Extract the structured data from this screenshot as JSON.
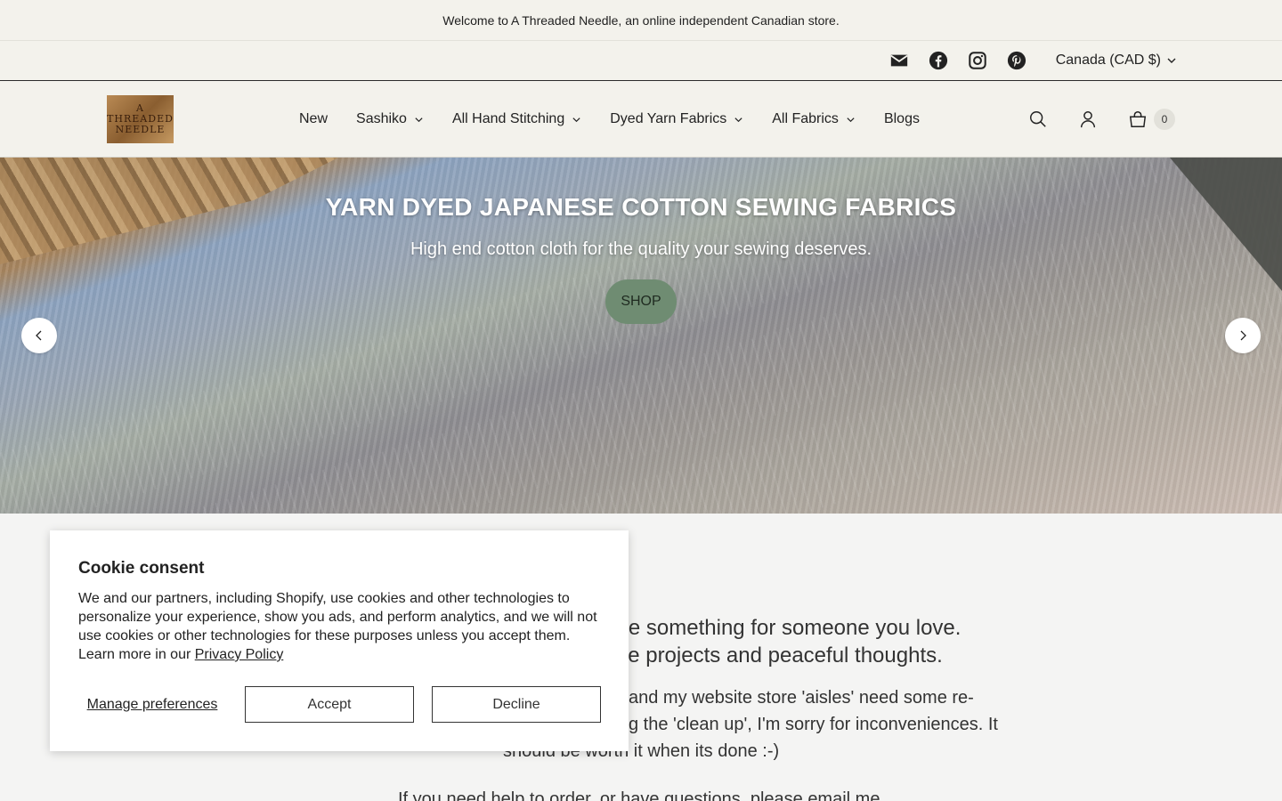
{
  "announcement": {
    "text": "Welcome to A Threaded Needle, an online independent Canadian store."
  },
  "utility": {
    "social_icons": [
      "mail-icon",
      "facebook-icon",
      "instagram-icon",
      "pinterest-icon"
    ],
    "currency": "Canada (CAD $)"
  },
  "header": {
    "logo_lines": [
      "A",
      "THREADED",
      "NEEDLE"
    ],
    "nav": [
      {
        "label": "New",
        "has_dropdown": false
      },
      {
        "label": "Sashiko",
        "has_dropdown": true
      },
      {
        "label": "All Hand Stitching",
        "has_dropdown": true
      },
      {
        "label": "Dyed Yarn Fabrics",
        "has_dropdown": true
      },
      {
        "label": "All Fabrics",
        "has_dropdown": true
      },
      {
        "label": "Blogs",
        "has_dropdown": false
      }
    ],
    "cart_count": "0"
  },
  "hero": {
    "title": "YARN DYED JAPANESE COTTON SEWING FABRICS",
    "subtitle": "High end cotton cloth for the quality your sewing deserves.",
    "button": "SHOP"
  },
  "intro": {
    "line1": "make something for someone you love.",
    "line2": "tive projects and peaceful thoughts.",
    "body1": "and my website store 'aisles' need some re-",
    "body2": "g the 'clean up', I'm sorry for inconveniences. It",
    "body3": "should be worth it when its done :-)",
    "body4": "If you need help to order, or have questions, please email me"
  },
  "cookie": {
    "title": "Cookie consent",
    "text": "We and our partners, including Shopify, use cookies and other technologies to personalize your experience, show you ads, and perform analytics, and we will not use cookies or other technologies for these purposes unless you accept them. Learn more in our ",
    "policy_link": "Privacy Policy",
    "manage": "Manage preferences",
    "accept": "Accept",
    "decline": "Decline"
  },
  "colors": {
    "shop_button": "#6f8c72",
    "header_bg": "#f3f2ec",
    "page_bg": "#f4f4f3"
  }
}
